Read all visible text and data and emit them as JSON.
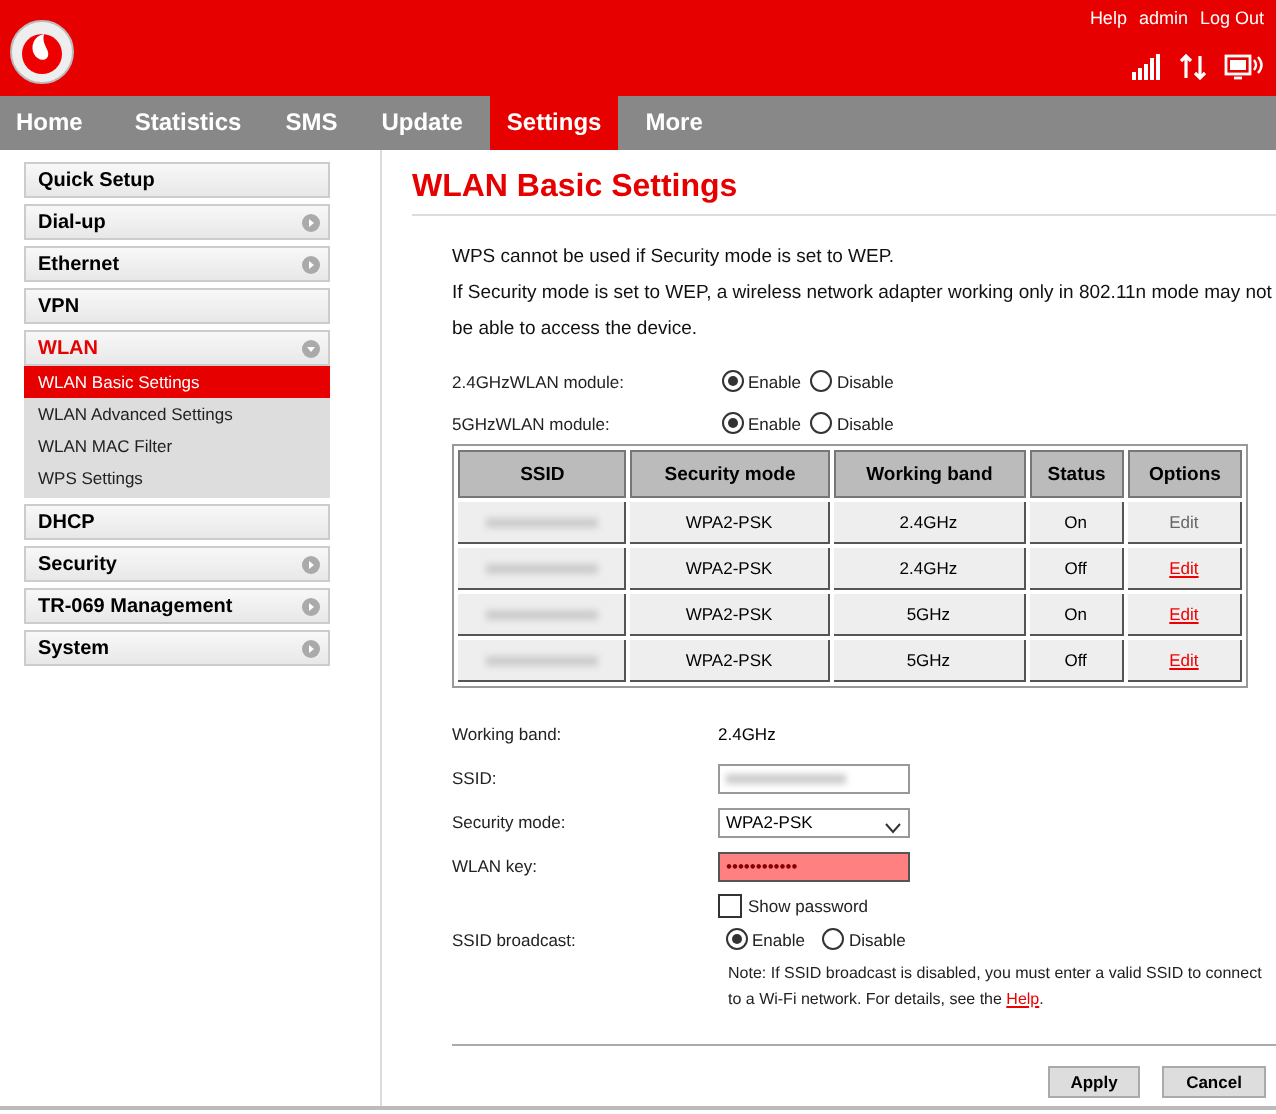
{
  "header": {
    "links": [
      "Help",
      "admin",
      "Log Out"
    ]
  },
  "nav": [
    {
      "label": "Home",
      "selected": false
    },
    {
      "label": "Statistics",
      "selected": false
    },
    {
      "label": "SMS",
      "selected": false
    },
    {
      "label": "Update",
      "selected": false
    },
    {
      "label": "Settings",
      "selected": true
    },
    {
      "label": "More",
      "selected": false
    }
  ],
  "sidebar": [
    {
      "label": "Quick Setup",
      "kind": "plain"
    },
    {
      "label": "Dial-up",
      "kind": "arrow"
    },
    {
      "label": "Ethernet",
      "kind": "arrow"
    },
    {
      "label": "VPN",
      "kind": "plain"
    },
    {
      "label": "WLAN",
      "kind": "expanded",
      "children": [
        {
          "label": "WLAN Basic Settings",
          "selected": true
        },
        {
          "label": "WLAN Advanced Settings",
          "selected": false
        },
        {
          "label": "WLAN MAC Filter",
          "selected": false
        },
        {
          "label": "WPS Settings",
          "selected": false
        }
      ]
    },
    {
      "label": "DHCP",
      "kind": "plain"
    },
    {
      "label": "Security",
      "kind": "arrow"
    },
    {
      "label": "TR-069 Management",
      "kind": "arrow"
    },
    {
      "label": "System",
      "kind": "arrow"
    }
  ],
  "title": "WLAN Basic Settings",
  "notes": [
    "WPS cannot be used if Security mode is set to WEP.",
    "If Security mode is set to WEP, a wireless network adapter working only in 802.11n mode may not be able to access the device."
  ],
  "modules": [
    {
      "label": "2.4GHzWLAN module:",
      "options": [
        {
          "label": "Enable",
          "selected": true
        },
        {
          "label": "Disable",
          "selected": false
        }
      ]
    },
    {
      "label": "5GHzWLAN module:",
      "options": [
        {
          "label": "Enable",
          "selected": true
        },
        {
          "label": "Disable",
          "selected": false
        }
      ]
    }
  ],
  "table": {
    "columns": [
      "SSID",
      "Security mode",
      "Working band",
      "Status",
      "Options"
    ],
    "rows": [
      {
        "security": "WPA2-PSK",
        "band": "2.4GHz",
        "status": "On",
        "option": "Edit",
        "selected": true
      },
      {
        "security": "WPA2-PSK",
        "band": "2.4GHz",
        "status": "Off",
        "option": "Edit",
        "selected": false
      },
      {
        "security": "WPA2-PSK",
        "band": "5GHz",
        "status": "On",
        "option": "Edit",
        "selected": false
      },
      {
        "security": "WPA2-PSK",
        "band": "5GHz",
        "status": "Off",
        "option": "Edit",
        "selected": false
      }
    ]
  },
  "form": {
    "band_label": "Working band:",
    "band": "2.4GHz",
    "ssid_label": "SSID:",
    "security_label": "Security mode:",
    "security": "WPA2-PSK",
    "key_label": "WLAN key:",
    "key": "••••••••••••",
    "key_invalid": true,
    "show_password": {
      "label": "Show password",
      "checked": false
    },
    "broadcast_label": "SSID broadcast:",
    "broadcast": [
      {
        "label": "Enable",
        "selected": true
      },
      {
        "label": "Disable",
        "selected": false
      }
    ],
    "note": "Note: If SSID broadcast is disabled, you must enter a valid SSID to connect to a Wi-Fi network. For details, see the",
    "note_link": "Help",
    "note_end": "."
  },
  "buttons": [
    "Apply",
    "Cancel"
  ]
}
